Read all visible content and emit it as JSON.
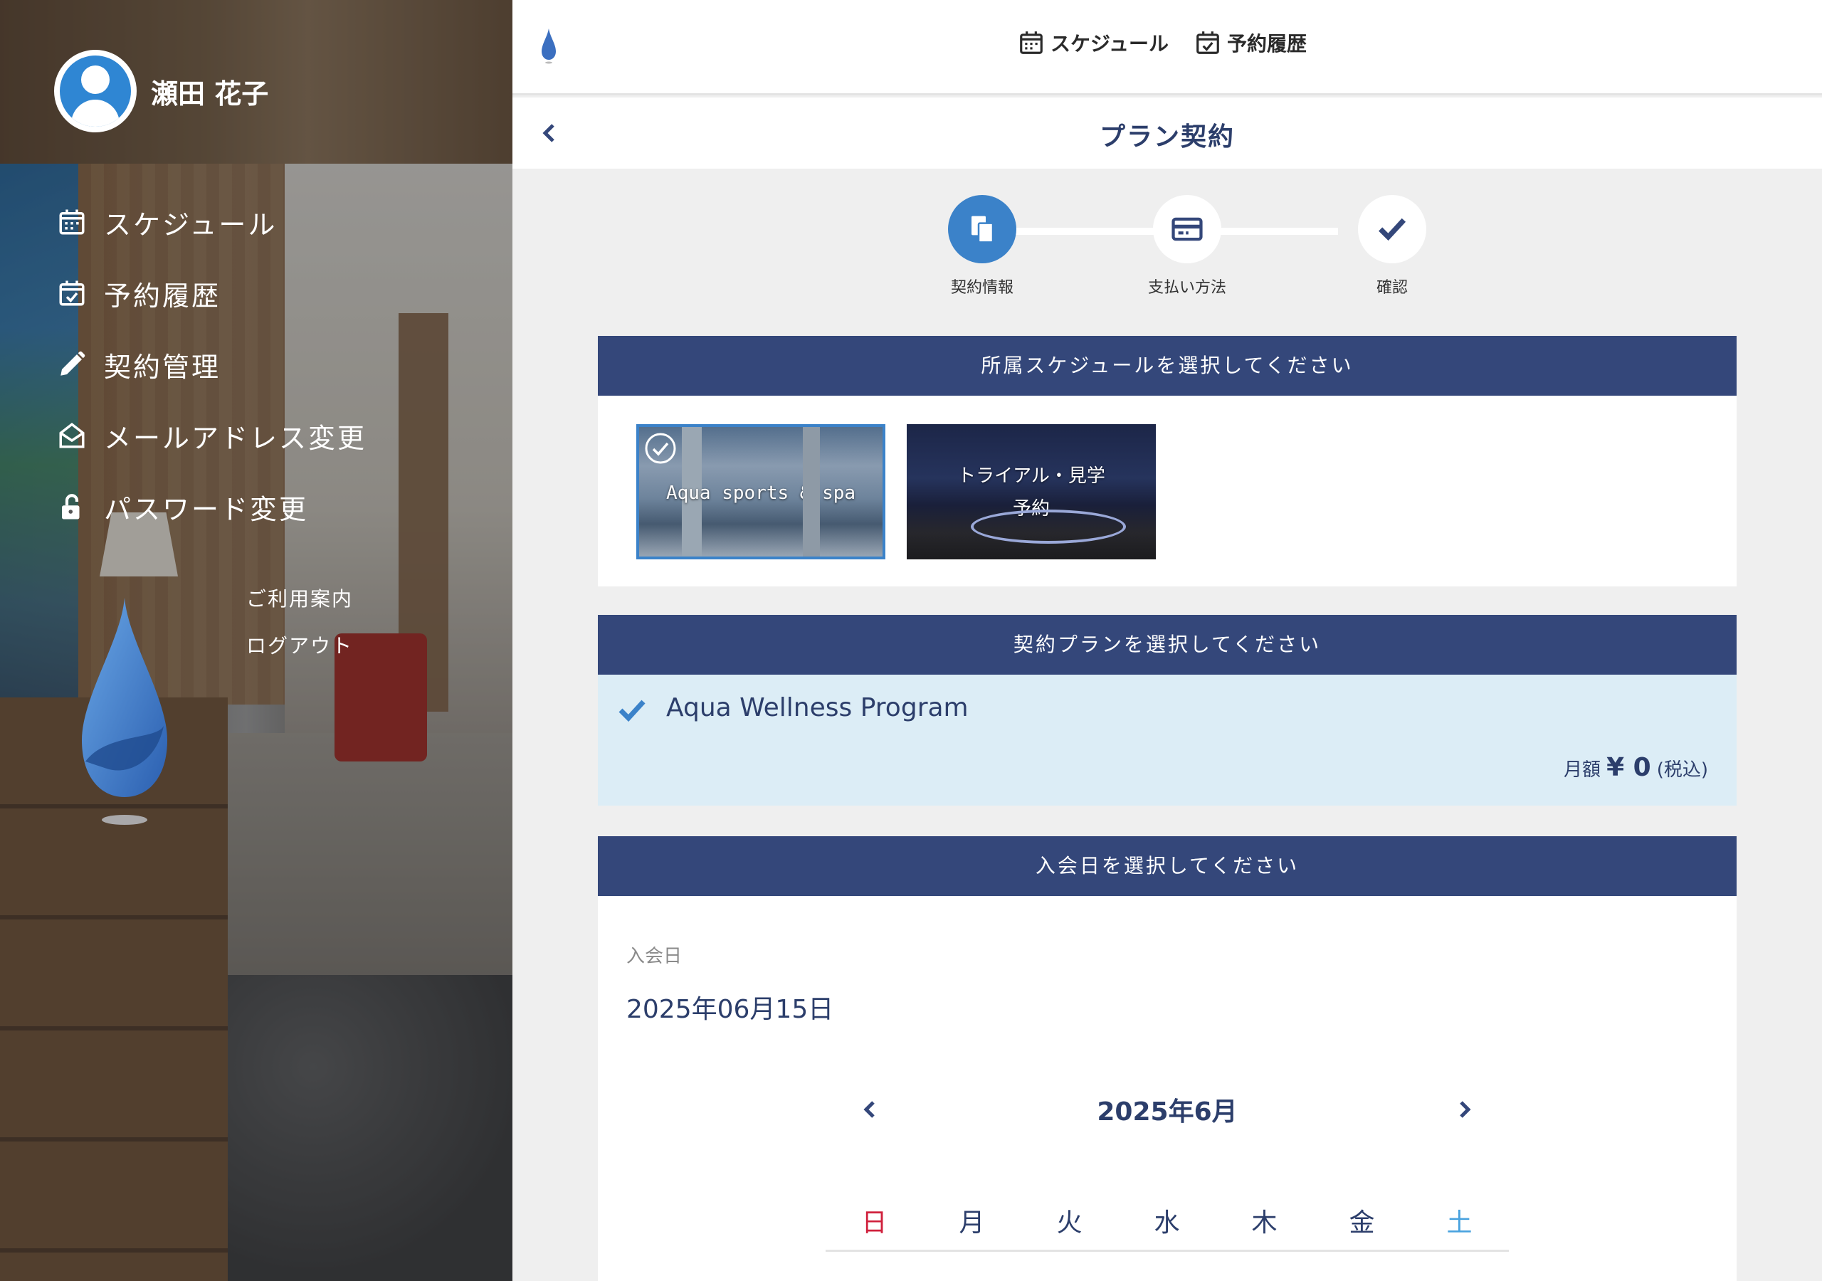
{
  "user": {
    "name": "瀬田 花子"
  },
  "sidebar": {
    "items": [
      {
        "label": "スケジュール",
        "icon": "calendar-icon"
      },
      {
        "label": "予約履歴",
        "icon": "calendar-check-icon"
      },
      {
        "label": "契約管理",
        "icon": "pencil-icon"
      },
      {
        "label": "メールアドレス変更",
        "icon": "envelope-open-icon"
      },
      {
        "label": "パスワード変更",
        "icon": "unlock-icon"
      }
    ],
    "links": [
      {
        "label": "ご利用案内"
      },
      {
        "label": "ログアウト"
      }
    ]
  },
  "topnav": {
    "items": [
      {
        "label": "スケジュール",
        "icon": "calendar-icon"
      },
      {
        "label": "予約履歴",
        "icon": "calendar-check-icon"
      }
    ]
  },
  "header": {
    "title": "プラン契約"
  },
  "stepper": {
    "steps": [
      {
        "label": "契約情報",
        "icon": "clipboard-copy-icon",
        "active": true
      },
      {
        "label": "支払い方法",
        "icon": "credit-card-icon",
        "active": false
      },
      {
        "label": "確認",
        "icon": "check-icon",
        "active": false
      }
    ]
  },
  "schedule_section": {
    "title": "所属スケジュールを選択してください",
    "cards": [
      {
        "label": "Aqua sports & spa",
        "selected": true
      },
      {
        "label": "トライアル・見学予約",
        "selected": false
      }
    ]
  },
  "plan_section": {
    "title": "契約プランを選択してください",
    "plan": {
      "name": "Aqua Wellness Program",
      "price_prefix": "月額",
      "price": "¥ 0",
      "price_suffix": "(税込)"
    }
  },
  "date_section": {
    "title": "入会日を選択してください",
    "date_label": "入会日",
    "date_value": "2025年06月15日",
    "calendar": {
      "month": "2025年6月",
      "weekdays": [
        "日",
        "月",
        "火",
        "水",
        "木",
        "金",
        "土"
      ]
    }
  },
  "colors": {
    "accent": "#3b82c9",
    "navy": "#34477a",
    "text_navy": "#2c3e6b",
    "plan_bg": "#dcedf6",
    "sunday": "#d0213d",
    "saturday": "#4aa3df"
  }
}
